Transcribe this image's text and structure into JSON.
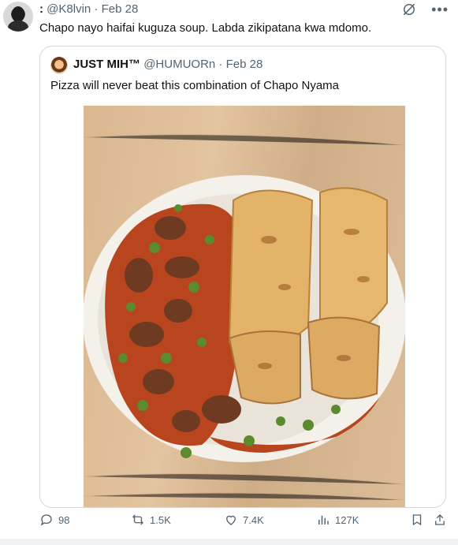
{
  "tweet": {
    "name_prefix": ":",
    "handle": "@K8lvin",
    "separator": "·",
    "date": "Feb 28",
    "text": "Chapo nayo haifai kuguza soup. Labda zikipatana kwa mdomo."
  },
  "quote": {
    "name": "JUST MIH™",
    "handle": "@HUMUORn",
    "separator": "·",
    "date": "Feb 28",
    "text": "Pizza will never beat this combination of Chapo Nyama"
  },
  "actions": {
    "replies": "98",
    "reposts": "1.5K",
    "likes": "7.4K",
    "views": "127K"
  },
  "icons": {
    "reply": "reply-icon",
    "repost": "repost-icon",
    "like": "heart-icon",
    "views": "views-icon",
    "bookmark": "bookmark-icon",
    "share": "share-icon",
    "more": "more-icon",
    "grok": "grok-icon"
  }
}
